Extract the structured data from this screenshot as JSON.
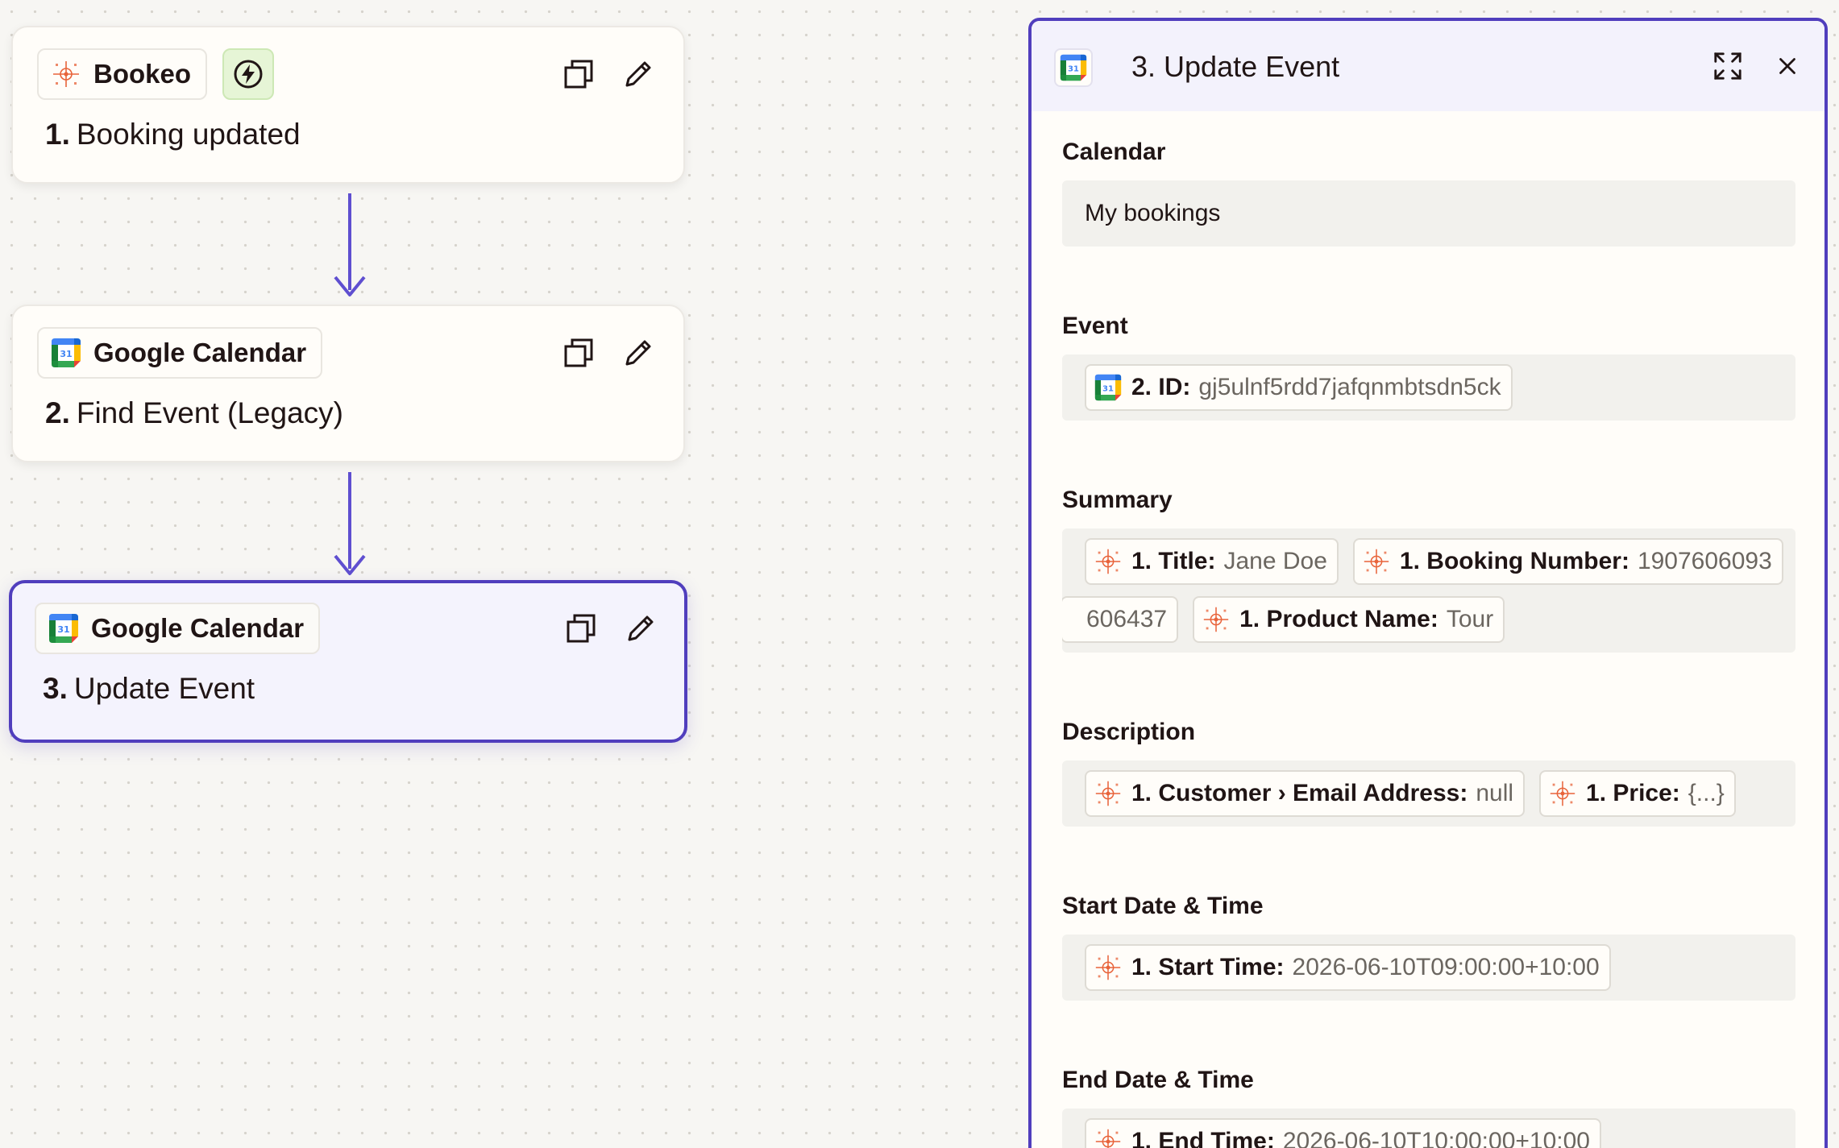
{
  "canvas": {
    "steps": [
      {
        "number": "1.",
        "title": "Booking updated",
        "app_name": "Bookeo",
        "app_icon": "bookeo-icon",
        "trigger_icon": "lightning-bolt-icon",
        "selected": false
      },
      {
        "number": "2.",
        "title": "Find Event (Legacy)",
        "app_name": "Google Calendar",
        "app_icon": "google-calendar-icon",
        "selected": false
      },
      {
        "number": "3.",
        "title": "Update Event",
        "app_name": "Google Calendar",
        "app_icon": "google-calendar-icon",
        "selected": true
      }
    ],
    "card_action_icons": [
      "duplicate-icon",
      "edit-pencil-icon"
    ]
  },
  "panel": {
    "title": "3. Update Event",
    "app_icon": "google-calendar-icon",
    "header_icons": [
      "expand-icon",
      "close-icon"
    ],
    "fields": {
      "calendar": {
        "label": "Calendar",
        "value": "My bookings"
      },
      "event": {
        "label": "Event",
        "pills": [
          {
            "icon": "google-calendar-icon",
            "label": "2. ID:",
            "value": "gj5ulnf5rdd7jafqnmbtsdn5ck"
          }
        ]
      },
      "summary": {
        "label": "Summary",
        "pills": [
          {
            "icon": "bookeo-icon",
            "label": "1. Title:",
            "value": "Jane Doe"
          },
          {
            "icon": "bookeo-icon",
            "label": "1. Booking Number:",
            "value": "1907606093"
          },
          {
            "icon": "",
            "label": "",
            "value": "606437"
          },
          {
            "icon": "bookeo-icon",
            "label": "1. Product Name:",
            "value": "Tour"
          }
        ]
      },
      "description": {
        "label": "Description",
        "pills": [
          {
            "icon": "bookeo-icon",
            "label": "1. Customer › Email Address:",
            "value": "null"
          },
          {
            "icon": "bookeo-icon",
            "label": "1. Price:",
            "value": "{...}"
          }
        ]
      },
      "start": {
        "label": "Start Date & Time",
        "pills": [
          {
            "icon": "bookeo-icon",
            "label": "1. Start Time:",
            "value": "2026-06-10T09:00:00+10:00"
          }
        ]
      },
      "end": {
        "label": "End Date & Time",
        "pills": [
          {
            "icon": "bookeo-icon",
            "label": "1. End Time:",
            "value": "2026-06-10T10:00:00+10:00"
          }
        ]
      }
    }
  },
  "colors": {
    "accent": "#503ebd",
    "connector": "#5f4fd0",
    "canvas_bg": "#f7f6f3",
    "bookeo_brand": "#e8633a",
    "trigger_green": "#e6f5d6"
  }
}
